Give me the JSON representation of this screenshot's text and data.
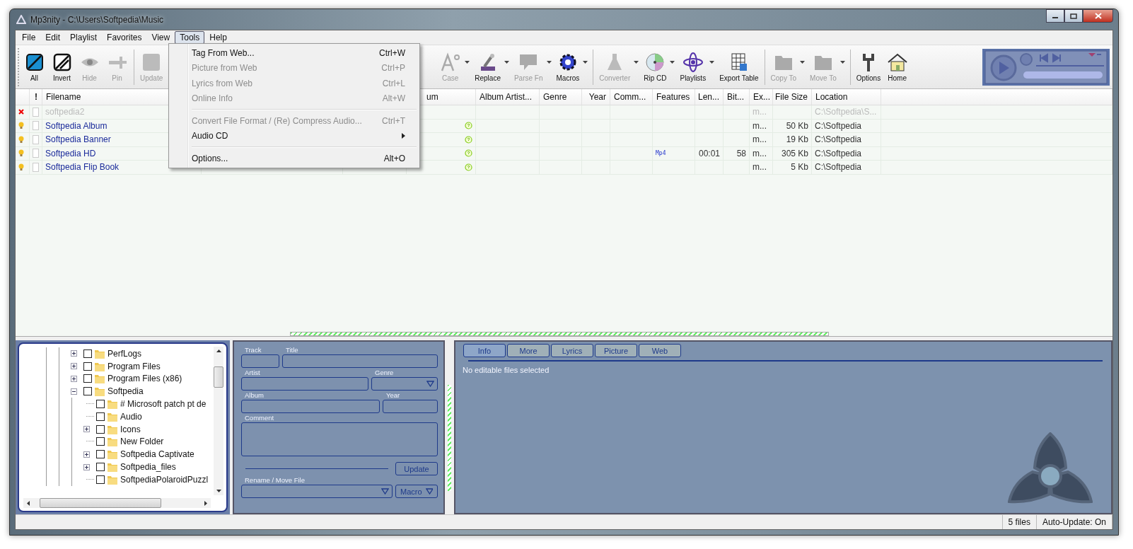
{
  "window": {
    "title": "Mp3nity - C:\\Users\\Softpedia\\Music"
  },
  "menu_bar": [
    {
      "label": "File",
      "selected": false
    },
    {
      "label": "Edit",
      "selected": false
    },
    {
      "label": "Playlist",
      "selected": false
    },
    {
      "label": "Favorites",
      "selected": false
    },
    {
      "label": "View",
      "selected": false
    },
    {
      "label": "Tools",
      "selected": true
    },
    {
      "label": "Help",
      "selected": false
    }
  ],
  "toolbar_left": [
    {
      "label": "All",
      "disabled": false,
      "dropdown": false,
      "group_start": false
    },
    {
      "label": "Invert",
      "disabled": false,
      "dropdown": false,
      "group_start": false
    },
    {
      "label": "Hide",
      "disabled": true,
      "dropdown": false,
      "group_start": false
    },
    {
      "label": "Pin",
      "disabled": true,
      "dropdown": false,
      "group_start": false
    },
    {
      "label": "Update",
      "disabled": true,
      "dropdown": false,
      "group_start": true
    }
  ],
  "toolbar_right": [
    {
      "label": "Case",
      "disabled": true,
      "dropdown": true,
      "group_start": false
    },
    {
      "label": "Replace",
      "disabled": false,
      "dropdown": true,
      "group_start": false
    },
    {
      "label": "Parse Fn",
      "disabled": true,
      "dropdown": true,
      "group_start": false
    },
    {
      "label": "Macros",
      "disabled": false,
      "dropdown": true,
      "group_start": false
    },
    {
      "label": "Converter",
      "disabled": true,
      "dropdown": true,
      "group_start": true
    },
    {
      "label": "Rip CD",
      "disabled": false,
      "dropdown": true,
      "group_start": false
    },
    {
      "label": "Playlists",
      "disabled": false,
      "dropdown": true,
      "group_start": false
    },
    {
      "label": "Export Table",
      "disabled": false,
      "dropdown": false,
      "group_start": false
    },
    {
      "label": "Copy To",
      "disabled": true,
      "dropdown": true,
      "group_start": true
    },
    {
      "label": "Move To",
      "disabled": true,
      "dropdown": true,
      "group_start": false
    },
    {
      "label": "Options",
      "disabled": false,
      "dropdown": false,
      "group_start": true
    },
    {
      "label": "Home",
      "disabled": false,
      "dropdown": false,
      "group_start": false
    }
  ],
  "tools_menu": [
    {
      "kind": "item",
      "label": "Tag From Web...",
      "shortcut": "Ctrl+W",
      "disabled": false
    },
    {
      "kind": "item",
      "label": "Picture from Web",
      "shortcut": "Ctrl+P",
      "disabled": true
    },
    {
      "kind": "item",
      "label": "Lyrics from Web",
      "shortcut": "Ctrl+L",
      "disabled": true
    },
    {
      "kind": "item",
      "label": "Online Info",
      "shortcut": "Alt+W",
      "disabled": true
    },
    {
      "kind": "separator"
    },
    {
      "kind": "item",
      "label": "Convert File Format / (Re) Compress Audio...",
      "shortcut": "Ctrl+T",
      "disabled": true
    },
    {
      "kind": "submenu",
      "label": "Audio CD",
      "disabled": false
    },
    {
      "kind": "separator"
    },
    {
      "kind": "item",
      "label": "Options...",
      "shortcut": "Alt+O",
      "disabled": false
    }
  ],
  "table": {
    "columns": [
      "!",
      "Filename",
      "um",
      "Album Artist...",
      "Genre",
      "Year",
      "Comm...",
      "Features",
      "Len...",
      "Bit...",
      "Ex...",
      "File Size",
      "Location"
    ],
    "rows": [
      {
        "kind": "missing",
        "checked": false,
        "disabled": true,
        "filename": "softpedia2",
        "lyrics": false,
        "features": "",
        "length": "",
        "bitrate": "",
        "ext": "m...",
        "size": "",
        "location": "C:\\Softpedia\\S..."
      },
      {
        "kind": "found",
        "checked": false,
        "disabled": false,
        "filename": "Softpedia Album",
        "lyrics": true,
        "features": "",
        "length": "",
        "bitrate": "",
        "ext": "m...",
        "size": "50 Kb",
        "location": "C:\\Softpedia"
      },
      {
        "kind": "found",
        "checked": false,
        "disabled": false,
        "filename": "Softpedia Banner",
        "lyrics": true,
        "features": "",
        "length": "",
        "bitrate": "",
        "ext": "m...",
        "size": "19 Kb",
        "location": "C:\\Softpedia"
      },
      {
        "kind": "found",
        "checked": false,
        "disabled": false,
        "filename": "Softpedia HD",
        "lyrics": true,
        "features": "Mp4",
        "length": "00:01",
        "bitrate": "58",
        "ext": "m...",
        "size": "305 Kb",
        "location": "C:\\Softpedia"
      },
      {
        "kind": "found",
        "checked": false,
        "disabled": false,
        "filename": "Softpedia Flip Book",
        "lyrics": true,
        "features": "",
        "length": "",
        "bitrate": "",
        "ext": "m...",
        "size": "5 Kb",
        "location": "C:\\Softpedia"
      }
    ]
  },
  "folder_tree": [
    {
      "label": "PerfLogs",
      "checked": false,
      "expanded": false
    },
    {
      "label": "Program Files",
      "checked": false,
      "expanded": false
    },
    {
      "label": "Program Files (x86)",
      "checked": false,
      "expanded": false
    },
    {
      "label": "Softpedia",
      "checked": false,
      "expanded": true,
      "children": [
        {
          "label": "# Microsoft patch pt de",
          "checked": false
        },
        {
          "label": "Audio",
          "checked": false
        },
        {
          "label": "Icons",
          "checked": false,
          "expanded": false
        },
        {
          "label": "New Folder",
          "checked": false
        },
        {
          "label": "Softpedia Captivate",
          "checked": false,
          "expanded": false
        },
        {
          "label": "Softpedia_files",
          "checked": false,
          "expanded": false
        },
        {
          "label": "SoftpediaPolaroidPuzzl",
          "checked": false
        }
      ]
    }
  ],
  "tag_editor": {
    "track_label": "Track",
    "title_label": "Title",
    "artist_label": "Artist",
    "genre_label": "Genre",
    "album_label": "Album",
    "year_label": "Year",
    "comment_label": "Comment",
    "rename_label": "Rename / Move File",
    "update_button": "Update",
    "macro_button": "Macro"
  },
  "info_panel": {
    "tabs": [
      {
        "label": "Info",
        "selected": true
      },
      {
        "label": "More",
        "selected": false
      },
      {
        "label": "Lyrics",
        "selected": false
      },
      {
        "label": "Picture",
        "selected": false
      },
      {
        "label": "Web",
        "selected": false
      }
    ],
    "message": "No editable files selected"
  },
  "status_bar": {
    "file_count": "5 files",
    "auto_update": "Auto-Update: On"
  }
}
